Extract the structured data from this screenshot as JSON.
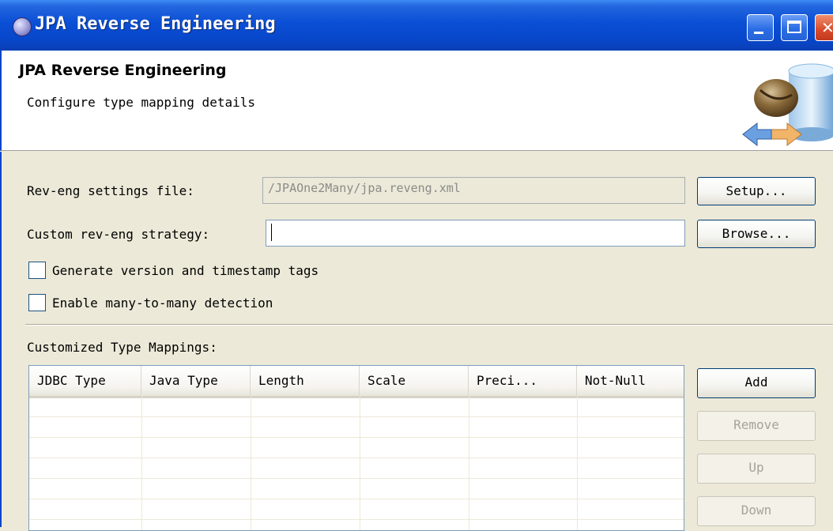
{
  "window": {
    "title": "JPA Reverse Engineering",
    "buttons": [
      "minimize",
      "maximize",
      "close"
    ]
  },
  "header": {
    "title": "JPA Reverse Engineering",
    "subtitle": "Configure type mapping details",
    "image": "database-coffee-bean-icon"
  },
  "form": {
    "settings_file_label": "Rev-eng settings file:",
    "settings_file_value": "/JPAOne2Many/jpa.reveng.xml",
    "setup_button": "Setup...",
    "strategy_label": "Custom rev-eng strategy:",
    "strategy_value": "",
    "browse_button": "Browse...",
    "checkbox_version_label": "Generate version and timestamp tags",
    "checkbox_version_checked": false,
    "checkbox_many_label": "Enable many-to-many detection",
    "checkbox_many_checked": false
  },
  "mappings": {
    "label": "Customized Type Mappings:",
    "columns": [
      "JDBC Type",
      "Java Type",
      "Length",
      "Scale",
      "Preci...",
      "Not-Null"
    ],
    "rows": [],
    "buttons": {
      "add": "Add",
      "remove": "Remove",
      "up": "Up",
      "down": "Down"
    }
  },
  "colors": {
    "titlebar": "#0a4fd6",
    "dialog_bg": "#ece9d8"
  }
}
